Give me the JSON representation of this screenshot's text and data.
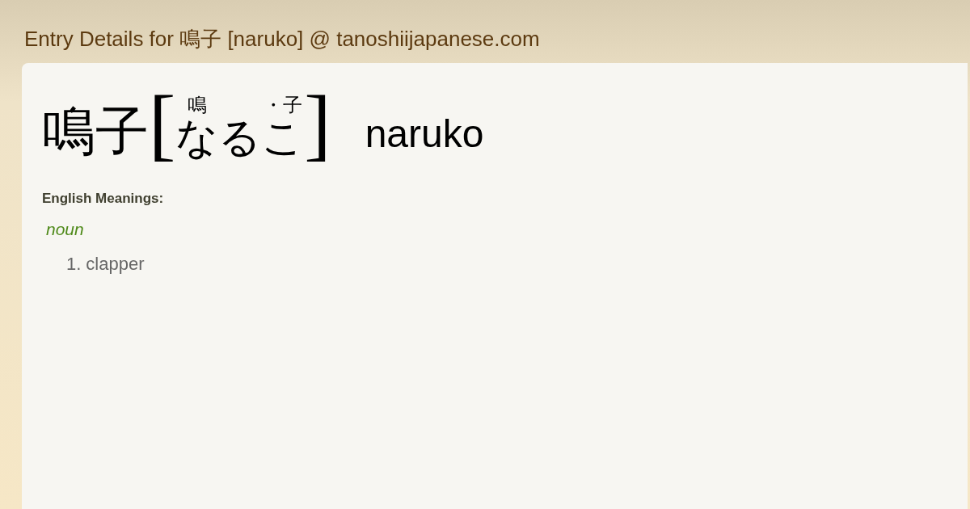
{
  "page": {
    "title": "Entry Details for 鳴子 [naruko] @ tanoshiijapanese.com"
  },
  "entry": {
    "word": "鳴子",
    "open_bracket": "[",
    "close_bracket": "]",
    "reading": [
      {
        "kana": "な",
        "furigana": "鳴"
      },
      {
        "kana": "る"
      },
      {
        "kana": "こ",
        "furigana": "・子"
      }
    ],
    "romaji": "naruko"
  },
  "meanings": {
    "heading": "English Meanings:",
    "groups": [
      {
        "part_of_speech": "noun",
        "senses": [
          {
            "number": "1.",
            "text": "clapper"
          }
        ]
      }
    ]
  }
}
